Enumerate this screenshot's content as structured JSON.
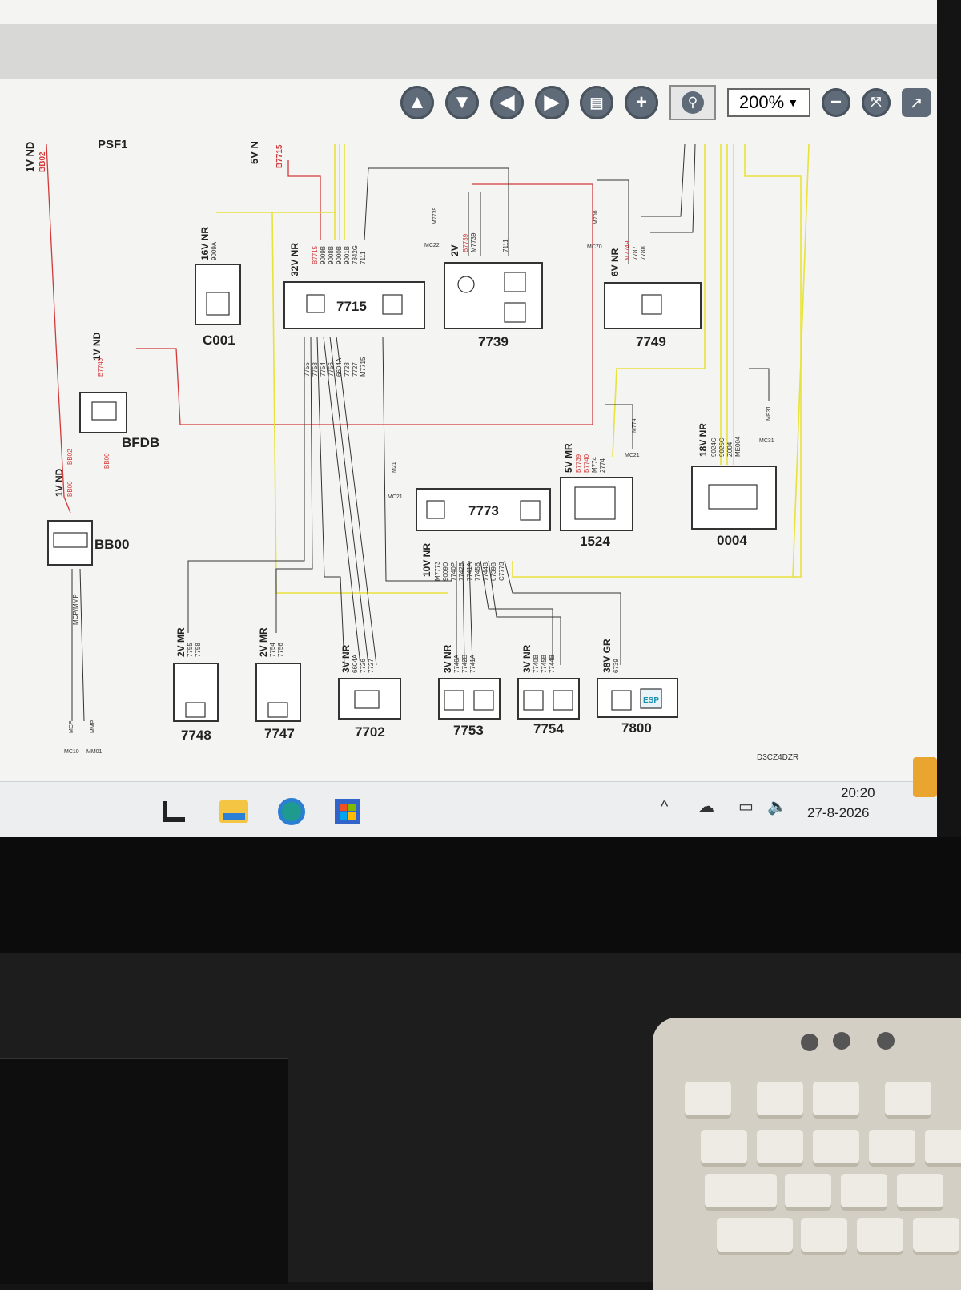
{
  "toolbar": {
    "zoom_value": "200%",
    "buttons": [
      "arrow-up",
      "arrow-down",
      "arrow-left",
      "arrow-right",
      "print",
      "plus",
      "search",
      "minus",
      "fit",
      "export"
    ]
  },
  "diagram": {
    "top_labels": {
      "psf1": "PSF1",
      "five_v": "5V N",
      "b7715": "B7715",
      "one_v_top": "1V ND",
      "bb02_top": "BB02"
    },
    "components": [
      {
        "id": "BB00",
        "label": "BB00",
        "conn": "1V ND"
      },
      {
        "id": "BFDB",
        "label": "BFDB",
        "conn": "1V ND"
      },
      {
        "id": "C001",
        "label": "C001",
        "conn": "16V NR"
      },
      {
        "id": "7715",
        "label": "7715",
        "conn": "32V NR"
      },
      {
        "id": "7739",
        "label": "7739",
        "conn": "2V"
      },
      {
        "id": "7749",
        "label": "7749",
        "conn": "6V NR"
      },
      {
        "id": "7773",
        "label": "7773",
        "conn": "10V NR"
      },
      {
        "id": "1524",
        "label": "1524",
        "conn": "5V MR"
      },
      {
        "id": "0004",
        "label": "0004",
        "conn": "18V NR"
      },
      {
        "id": "7748",
        "label": "7748",
        "conn": "2V MR"
      },
      {
        "id": "7747",
        "label": "7747",
        "conn": "2V MR"
      },
      {
        "id": "7702",
        "label": "7702",
        "conn": "3V NR"
      },
      {
        "id": "7753",
        "label": "7753",
        "conn": "3V NR"
      },
      {
        "id": "7754",
        "label": "7754",
        "conn": "3V NR"
      },
      {
        "id": "7800",
        "label": "7800",
        "conn": "38V GR"
      }
    ],
    "wires_7715": [
      "B7715",
      "9009B",
      "9008B",
      "9000B",
      "9001B",
      "7842G",
      "7111"
    ],
    "wires_7715_bottom": [
      "7755",
      "7758",
      "7754",
      "7756",
      "6604A",
      "7728",
      "7727",
      "M7715"
    ],
    "wires_7773": [
      "M7773",
      "9009D",
      "7740P",
      "7742B",
      "7741A",
      "7745B",
      "7744B",
      "6739B",
      "C7773"
    ],
    "wires_1524": [
      "B7739",
      "B7740",
      "M774",
      "2774"
    ],
    "wires_0004": [
      "9024C",
      "9025C",
      "Z004",
      "ME004"
    ],
    "wires_7749": [
      "M7749",
      "7787",
      "7788"
    ],
    "grounds": [
      "MC22",
      "M7739",
      "M700",
      "MC70",
      "M21",
      "MC21",
      "M774",
      "MC21",
      "ME31",
      "MC31",
      "MCP",
      "MC10",
      "MMP",
      "MM01"
    ],
    "bb00_wires": [
      "BB00",
      "BB02",
      "MCP/MMP"
    ],
    "bfdb_wires": [
      "BB00",
      "B7740"
    ],
    "c001_wire": "9009A",
    "wires_7739": [
      "B7739",
      "M7739",
      "7111"
    ],
    "wires_7748": [
      "7755",
      "7758"
    ],
    "wires_7747": [
      "7754",
      "7756"
    ],
    "wires_7702": [
      "6604A",
      "7726",
      "7727"
    ],
    "wires_7753": [
      "7740A",
      "7742B",
      "7741A"
    ],
    "wires_7754": [
      "7740B",
      "7745B",
      "7744B"
    ],
    "wires_7800": [
      "6739"
    ],
    "esp_label": "ESP",
    "drawing_code": "D3CZ4DZR"
  },
  "taskbar": {
    "time": "20:20",
    "date": "27-8-2026",
    "icons": [
      "start-icon",
      "file-explorer-icon",
      "edge-icon",
      "store-icon"
    ]
  },
  "colors": {
    "red_wire": "#d23a3a",
    "yellow_wire": "#e8e23a",
    "black_wire": "#333333",
    "toolbar_button": "#5f6b78"
  }
}
